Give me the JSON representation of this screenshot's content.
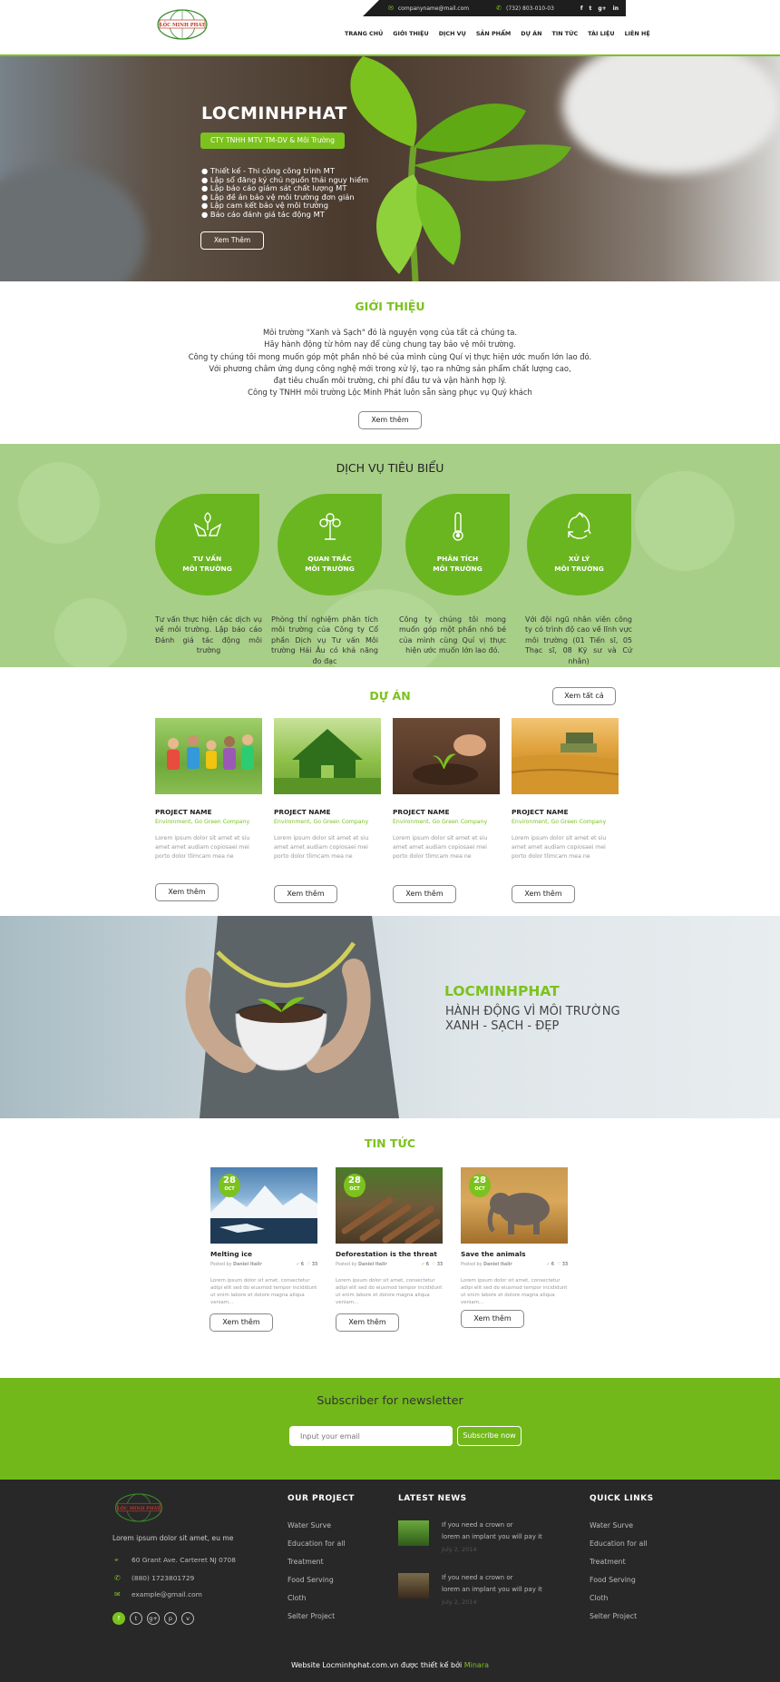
{
  "colors": {
    "accent": "#7cc21e",
    "dark": "#282828"
  },
  "header": {
    "logo_text": "LỘC MINH PHÁT",
    "email": "companyname@mail.com",
    "phone": "(732) 803-010-03",
    "social": [
      "f",
      "t",
      "g+",
      "in"
    ],
    "nav": [
      "TRANG CHỦ",
      "GIỚI THIỆU",
      "DỊCH VỤ",
      "SẢN PHẨM",
      "DỰ ÁN",
      "TIN TỨC",
      "TÀI LIỆU",
      "LIÊN HỆ"
    ]
  },
  "hero": {
    "title": "LOCMINHPHAT",
    "badge": "CTY TNHH MTV TM-DV & Môi Trường",
    "bullets": [
      "● Thiết kế - Thi công công trình MT",
      "● Lập sổ đăng ký chủ nguồn thải nguy hiểm",
      "● Lập báo cáo giám sát chất lượng MT",
      "● Lập đề án bảo vệ môi trường đơn giản",
      "● Lập cam kết bảo vệ môi trường",
      "● Báo cáo đánh giá tác động MT"
    ],
    "button": "Xem Thêm"
  },
  "intro": {
    "title": "GIỚI THIỆU",
    "lines": [
      "Môi trường \"Xanh và Sạch\" đó là nguyện vọng của tất cả chúng ta.",
      "Hãy hành động từ hôm nay để cùng chung tay bảo vệ môi trường.",
      "Công ty chúng tôi mong muốn góp một phần nhỏ bé của mình cùng Quí vị thực hiện ước muốn lớn lao đó.",
      "Với phương châm ứng dụng công nghệ mới trong xử lý, tạo ra những sản phẩm chất lượng cao,",
      "đạt tiêu chuẩn môi trường, chi phí đầu tư và vận hành hợp lý.",
      "Công ty TNHH môi trường Lộc Minh Phát luôn sẵn sàng phục vụ Quý khách"
    ],
    "button": "Xem thêm"
  },
  "services": {
    "title": "DỊCH VỤ TIÊU BIỂU",
    "items": [
      {
        "icon": "hands-plant-icon",
        "l1": "TƯ VẤN",
        "l2": "MÔI TRƯỜNG",
        "desc": "Tư vấn thực hiện các dịch vụ về môi trường. Lập báo cáo Đánh giá tác động môi trường"
      },
      {
        "icon": "tree-icon",
        "l1": "QUAN TRẮC",
        "l2": "MÔI TRƯỜNG",
        "desc": "Phòng thí nghiệm phân tích môi trường của Công ty Cổ phần Dịch vụ Tư vấn Môi trường Hải Âu có khả năng đo đạc"
      },
      {
        "icon": "thermometer-icon",
        "l1": "PHÂN TÍCH",
        "l2": "MÔI TRƯỜNG",
        "desc": "Công ty chúng tôi mong muốn góp một phần nhỏ bé của mình cùng Quí vị thực hiện ước muốn lớn lao đó."
      },
      {
        "icon": "recycle-icon",
        "l1": "XỬ LÝ",
        "l2": "MÔI TRƯỜNG",
        "desc": "Với đội ngũ nhân viên công ty có trình độ cao về lĩnh vực môi trường (01 Tiến sĩ, 05 Thạc sĩ, 08 Kỹ sư và Cử nhân)"
      }
    ]
  },
  "projects": {
    "title": "DỰ ÁN",
    "view_all": "Xem tất cả",
    "items": [
      {
        "name": "PROJECT NAME",
        "cat": "Environment, Go Green Company",
        "desc": "Lorem ipsum dolor sit amet et siu amet amet audiam copiosaei mei porto dolor tlimcam mea ne",
        "button": "Xem thêm"
      },
      {
        "name": "PROJECT NAME",
        "cat": "Environment, Go Green Company",
        "desc": "Lorem ipsum dolor sit amet et siu amet amet audiam copiosaei mei porto dolor tlimcam mea ne",
        "button": "Xem thêm"
      },
      {
        "name": "PROJECT NAME",
        "cat": "Environment, Go Green Company",
        "desc": "Lorem ipsum dolor sit amet et siu amet amet audiam copiosaei mei porto dolor tlimcam mea ne",
        "button": "Xem thêm"
      },
      {
        "name": "PROJECT NAME",
        "cat": "Environment, Go Green Company",
        "desc": "Lorem ipsum dolor sit amet et siu amet amet audiam copiosaei mei porto dolor tlimcam mea ne",
        "button": "Xem thêm"
      }
    ]
  },
  "banner": {
    "title": "LOCMINHPHAT",
    "line1": "HÀNH ĐỘNG VÌ MÔI TRƯỜNG",
    "line2": "XANH - SẠCH - ĐẸP"
  },
  "news": {
    "title": "TIN TỨC",
    "items": [
      {
        "day": "28",
        "month": "OCT",
        "title": "Melting ice",
        "posted": "Posted by",
        "author": "Daniel Italir",
        "likes": "6",
        "hearts": "33",
        "desc": "Lorem ipsum dolor sit amet, consectetur adipi elit sed do eiusmod tempor incididunt ut enim labore et dolore magna aliqua veniam...",
        "button": "Xem thêm"
      },
      {
        "day": "28",
        "month": "OCT",
        "title": "Deforestation is the threat",
        "posted": "Posted by",
        "author": "Daniel Italir",
        "likes": "6",
        "hearts": "33",
        "desc": "Lorem ipsum dolor sit amet, consectetur adipi elit sed do eiusmod tempor incididunt ut enim labore et dolore magna aliqua veniam...",
        "button": "Xem thêm"
      },
      {
        "day": "28",
        "month": "OCT",
        "title": "Save the animals",
        "posted": "Posted by",
        "author": "Daniel Italir",
        "likes": "6",
        "hearts": "33",
        "desc": "Lorem ipsum dolor sit amet, consectetur adipi elit sed do eiusmod tempor incididunt ut enim labore et dolore magna aliqua veniam...",
        "button": "Xem thêm"
      }
    ]
  },
  "newsletter": {
    "title": "Subscriber for newsletter",
    "placeholder": "Input your email",
    "button": "Subscribe now"
  },
  "footer": {
    "tagline": "Lorem ipsum dolor sit amet, eu me",
    "address": "60 Grant Ave. Carteret NJ 0708",
    "phone": "(880) 1723801729",
    "email": "example@gmail.com",
    "social": [
      "f",
      "t",
      "g+",
      "p",
      "v"
    ],
    "our_project_title": "OUR PROJECT",
    "our_project": [
      "Water Surve",
      "Education for all",
      "Treatment",
      "Food Serving",
      "Cloth",
      "Selter Project"
    ],
    "latest_news_title": "LATEST NEWS",
    "latest_news": [
      {
        "l1": "If you need a crown or",
        "l2": "lorem an implant you will pay it",
        "date": "July 2, 2014"
      },
      {
        "l1": "If you need a crown or",
        "l2": "lorem an implant you will pay it",
        "date": "July 2, 2014"
      }
    ],
    "quick_links_title": "QUICK LINKS",
    "quick_links": [
      "Water Surve",
      "Education for all",
      "Treatment",
      "Food Serving",
      "Cloth",
      "Selter Project"
    ],
    "copyright_prefix": "Website Locminhphat.com.vn được thiết kế bởi",
    "copyright_brand": "Minara"
  }
}
